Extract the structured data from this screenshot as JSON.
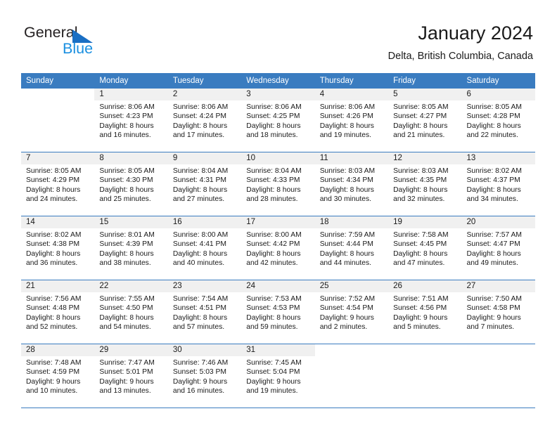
{
  "brand": {
    "name_part1": "General",
    "name_part2": "Blue",
    "triangle_icon": "triangle-icon",
    "accent_dark": "#1a6fc4",
    "accent_light": "#1a8fe0"
  },
  "header": {
    "title": "January 2024",
    "subtitle": "Delta, British Columbia, Canada",
    "header_bg": "#3a7cc0"
  },
  "weekday_headers": [
    "Sunday",
    "Monday",
    "Tuesday",
    "Wednesday",
    "Thursday",
    "Friday",
    "Saturday"
  ],
  "weeks": [
    [
      {
        "day": "",
        "lines": []
      },
      {
        "day": "1",
        "lines": [
          "Sunrise: 8:06 AM",
          "Sunset: 4:23 PM",
          "Daylight: 8 hours",
          "and 16 minutes."
        ]
      },
      {
        "day": "2",
        "lines": [
          "Sunrise: 8:06 AM",
          "Sunset: 4:24 PM",
          "Daylight: 8 hours",
          "and 17 minutes."
        ]
      },
      {
        "day": "3",
        "lines": [
          "Sunrise: 8:06 AM",
          "Sunset: 4:25 PM",
          "Daylight: 8 hours",
          "and 18 minutes."
        ]
      },
      {
        "day": "4",
        "lines": [
          "Sunrise: 8:06 AM",
          "Sunset: 4:26 PM",
          "Daylight: 8 hours",
          "and 19 minutes."
        ]
      },
      {
        "day": "5",
        "lines": [
          "Sunrise: 8:05 AM",
          "Sunset: 4:27 PM",
          "Daylight: 8 hours",
          "and 21 minutes."
        ]
      },
      {
        "day": "6",
        "lines": [
          "Sunrise: 8:05 AM",
          "Sunset: 4:28 PM",
          "Daylight: 8 hours",
          "and 22 minutes."
        ]
      }
    ],
    [
      {
        "day": "7",
        "lines": [
          "Sunrise: 8:05 AM",
          "Sunset: 4:29 PM",
          "Daylight: 8 hours",
          "and 24 minutes."
        ]
      },
      {
        "day": "8",
        "lines": [
          "Sunrise: 8:05 AM",
          "Sunset: 4:30 PM",
          "Daylight: 8 hours",
          "and 25 minutes."
        ]
      },
      {
        "day": "9",
        "lines": [
          "Sunrise: 8:04 AM",
          "Sunset: 4:31 PM",
          "Daylight: 8 hours",
          "and 27 minutes."
        ]
      },
      {
        "day": "10",
        "lines": [
          "Sunrise: 8:04 AM",
          "Sunset: 4:33 PM",
          "Daylight: 8 hours",
          "and 28 minutes."
        ]
      },
      {
        "day": "11",
        "lines": [
          "Sunrise: 8:03 AM",
          "Sunset: 4:34 PM",
          "Daylight: 8 hours",
          "and 30 minutes."
        ]
      },
      {
        "day": "12",
        "lines": [
          "Sunrise: 8:03 AM",
          "Sunset: 4:35 PM",
          "Daylight: 8 hours",
          "and 32 minutes."
        ]
      },
      {
        "day": "13",
        "lines": [
          "Sunrise: 8:02 AM",
          "Sunset: 4:37 PM",
          "Daylight: 8 hours",
          "and 34 minutes."
        ]
      }
    ],
    [
      {
        "day": "14",
        "lines": [
          "Sunrise: 8:02 AM",
          "Sunset: 4:38 PM",
          "Daylight: 8 hours",
          "and 36 minutes."
        ]
      },
      {
        "day": "15",
        "lines": [
          "Sunrise: 8:01 AM",
          "Sunset: 4:39 PM",
          "Daylight: 8 hours",
          "and 38 minutes."
        ]
      },
      {
        "day": "16",
        "lines": [
          "Sunrise: 8:00 AM",
          "Sunset: 4:41 PM",
          "Daylight: 8 hours",
          "and 40 minutes."
        ]
      },
      {
        "day": "17",
        "lines": [
          "Sunrise: 8:00 AM",
          "Sunset: 4:42 PM",
          "Daylight: 8 hours",
          "and 42 minutes."
        ]
      },
      {
        "day": "18",
        "lines": [
          "Sunrise: 7:59 AM",
          "Sunset: 4:44 PM",
          "Daylight: 8 hours",
          "and 44 minutes."
        ]
      },
      {
        "day": "19",
        "lines": [
          "Sunrise: 7:58 AM",
          "Sunset: 4:45 PM",
          "Daylight: 8 hours",
          "and 47 minutes."
        ]
      },
      {
        "day": "20",
        "lines": [
          "Sunrise: 7:57 AM",
          "Sunset: 4:47 PM",
          "Daylight: 8 hours",
          "and 49 minutes."
        ]
      }
    ],
    [
      {
        "day": "21",
        "lines": [
          "Sunrise: 7:56 AM",
          "Sunset: 4:48 PM",
          "Daylight: 8 hours",
          "and 52 minutes."
        ]
      },
      {
        "day": "22",
        "lines": [
          "Sunrise: 7:55 AM",
          "Sunset: 4:50 PM",
          "Daylight: 8 hours",
          "and 54 minutes."
        ]
      },
      {
        "day": "23",
        "lines": [
          "Sunrise: 7:54 AM",
          "Sunset: 4:51 PM",
          "Daylight: 8 hours",
          "and 57 minutes."
        ]
      },
      {
        "day": "24",
        "lines": [
          "Sunrise: 7:53 AM",
          "Sunset: 4:53 PM",
          "Daylight: 8 hours",
          "and 59 minutes."
        ]
      },
      {
        "day": "25",
        "lines": [
          "Sunrise: 7:52 AM",
          "Sunset: 4:54 PM",
          "Daylight: 9 hours",
          "and 2 minutes."
        ]
      },
      {
        "day": "26",
        "lines": [
          "Sunrise: 7:51 AM",
          "Sunset: 4:56 PM",
          "Daylight: 9 hours",
          "and 5 minutes."
        ]
      },
      {
        "day": "27",
        "lines": [
          "Sunrise: 7:50 AM",
          "Sunset: 4:58 PM",
          "Daylight: 9 hours",
          "and 7 minutes."
        ]
      }
    ],
    [
      {
        "day": "28",
        "lines": [
          "Sunrise: 7:48 AM",
          "Sunset: 4:59 PM",
          "Daylight: 9 hours",
          "and 10 minutes."
        ]
      },
      {
        "day": "29",
        "lines": [
          "Sunrise: 7:47 AM",
          "Sunset: 5:01 PM",
          "Daylight: 9 hours",
          "and 13 minutes."
        ]
      },
      {
        "day": "30",
        "lines": [
          "Sunrise: 7:46 AM",
          "Sunset: 5:03 PM",
          "Daylight: 9 hours",
          "and 16 minutes."
        ]
      },
      {
        "day": "31",
        "lines": [
          "Sunrise: 7:45 AM",
          "Sunset: 5:04 PM",
          "Daylight: 9 hours",
          "and 19 minutes."
        ]
      },
      {
        "day": "",
        "lines": []
      },
      {
        "day": "",
        "lines": []
      },
      {
        "day": "",
        "lines": []
      }
    ]
  ]
}
